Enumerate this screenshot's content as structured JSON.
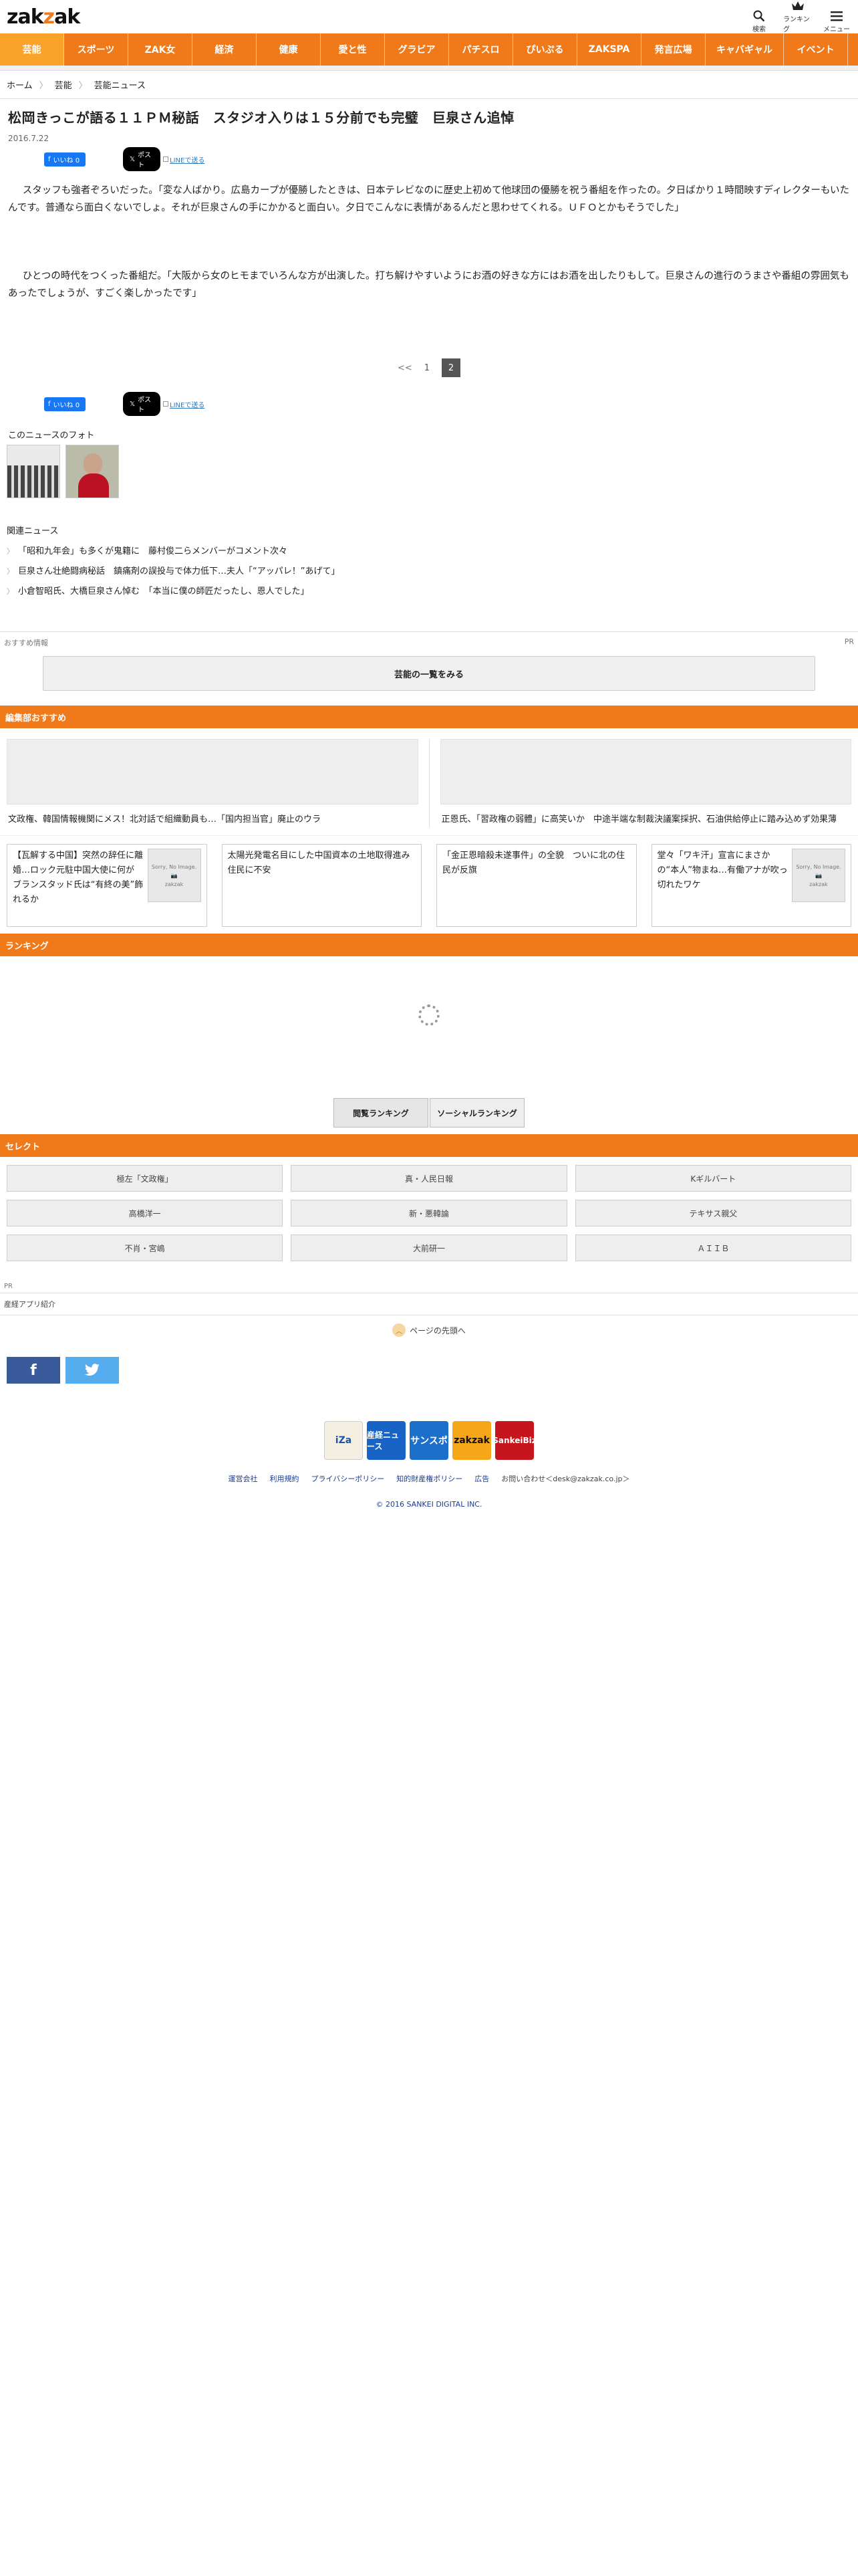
{
  "header": {
    "logo": "zakzak",
    "tools": [
      {
        "label": "検索",
        "icon": "search-icon"
      },
      {
        "label": "ランキング",
        "icon": "crown-icon"
      },
      {
        "label": "メニュー",
        "icon": "menu-icon"
      }
    ]
  },
  "nav": [
    "芸能",
    "スポーツ",
    "ZAK女",
    "経済",
    "健康",
    "愛と性",
    "グラビア",
    "パチスロ",
    "ぴいぷる",
    "ZAKSPA",
    "発言広場",
    "キャバギャル",
    "イベント"
  ],
  "breadcrumb": [
    "ホーム",
    "芸能",
    "芸能ニュース"
  ],
  "article": {
    "title": "松岡きっこが語る１１ＰＭ秘話　スタジオ入りは１５分前でも完璧　巨泉さん追悼",
    "date": "2016.7.22",
    "share": {
      "fb_label": "いいね 0",
      "x_label": "ポスト",
      "line_label": "LINEで送る"
    },
    "paragraphs": [
      "スタッフも強者ぞろいだった。「変な人ばかり。広島カープが優勝したときは、日本テレビなのに歴史上初めて他球団の優勝を祝う番組を作ったの。夕日ばかり１時間映すディレクターもいたんです。普通なら面白くないでしょ。それが巨泉さんの手にかかると面白い。夕日でこんなに表情があるんだと思わせてくれる。ＵＦＯとかもそうでした」",
      "ひとつの時代をつくった番組だ。「大阪から女のヒモまでいろんな方が出演した。打ち解けやすいようにお酒の好きな方にはお酒を出したりもして。巨泉さんの進行のうまさや番組の雰囲気もあったでしょうが、すごく楽しかったです」"
    ],
    "pager": {
      "prev": "<<",
      "pages": [
        "1",
        "2"
      ],
      "current": "2"
    }
  },
  "photos": {
    "heading": "このニュースのフォト"
  },
  "related": {
    "heading": "関連ニュース",
    "items": [
      "「昭和九年会」も多くが鬼籍に　藤村俊二らメンバーがコメント次々",
      "巨泉さん壮絶闘病秘話　鎮痛剤の誤投与で体力低下…夫人「“アッパレ！”あげて」",
      "小倉智昭氏、大橋巨泉さん悼む　「本当に僕の師匠だったし、恩人でした」"
    ]
  },
  "recommend": {
    "label": "おすすめ情報",
    "pr": "PR",
    "button": "芸能の一覧をみる"
  },
  "editor": {
    "heading": "編集部おすすめ",
    "large": [
      "文政権、韓国情報機関にメス！北対話で組織動員も…「国内担当官」廃止のウラ",
      "正恩氏、「習政権の弱體」に高笑いか　中途半端な制裁決議案採択、石油供給停止に踏み込めず効果薄"
    ],
    "small": [
      "【瓦解する中国】突然の辞任に離婚…ロック元駐中国大使に何が　ブランスタッド氏は“有終の美”飾れるか",
      "太陽光発電名目にした中国資本の土地取得進み住民に不安",
      "「金正恩暗殺未遂事件」の全貌　ついに北の住民が反旗",
      "堂々「ワキ汗」宣言にまさかの“本人”物まね…有働アナが吹っ切れたワケ"
    ],
    "noimage_text": "Sorry, No Image.",
    "noimage_logo": "zakzak"
  },
  "ranking": {
    "heading": "ランキング",
    "tabs": [
      "閲覧ランキング",
      "ソーシャルランキング"
    ]
  },
  "select": {
    "heading": "セレクト",
    "items": [
      "極左「文政権」",
      "真・人民日報",
      "Kギルバート",
      "高橋洋一",
      "新・悪韓論",
      "テキサス親父",
      "不肖・宮嶋",
      "大前研一",
      "ＡＩＩＢ"
    ]
  },
  "footer": {
    "pr": "PR",
    "apps": "産経アプリ紹介",
    "to_top": "ページの先頭へ",
    "sns": [
      "f",
      "t"
    ],
    "brand_icons": [
      "iZa",
      "産経ニュース",
      "サンスポ",
      "zakzak",
      "SankeiBiz"
    ],
    "links": [
      "運営会社",
      "利用規約",
      "プライバシーポリシー",
      "知的財産権ポリシー",
      "広告",
      "お問い合わせ＜desk@zakzak.co.jp＞"
    ],
    "copyright": "© 2016 SANKEI DIGITAL INC."
  },
  "colors": {
    "accent": "#f07a1a",
    "accent_light": "#f9a32a"
  }
}
